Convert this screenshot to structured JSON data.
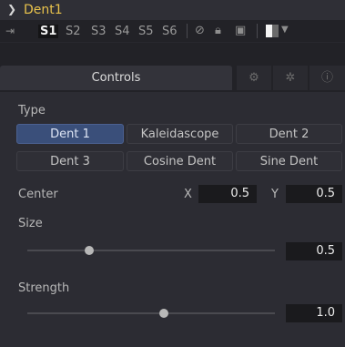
{
  "title": "Dent1",
  "versions": [
    "S1",
    "S2",
    "S3",
    "S4",
    "S5",
    "S6"
  ],
  "tabs": {
    "controls_label": "Controls"
  },
  "type_section": {
    "label": "Type",
    "options": [
      "Dent 1",
      "Kaleidascope",
      "Dent 2",
      "Dent 3",
      "Cosine Dent",
      "Sine Dent"
    ],
    "selected": "Dent 1"
  },
  "center": {
    "label": "Center",
    "x_label": "X",
    "x_value": "0.5",
    "y_label": "Y",
    "y_value": "0.5"
  },
  "size": {
    "label": "Size",
    "value": "0.5",
    "slider_fraction": 0.25
  },
  "strength": {
    "label": "Strength",
    "value": "1.0",
    "slider_fraction": 0.55
  },
  "icons": {
    "collapse": "chevron-down-icon",
    "pin": "pin-icon",
    "disable": "circle-slash-icon",
    "lock": "lock-icon",
    "save": "save-icon",
    "color": "color-swatch-icon",
    "tab2": "settings-cog-icon",
    "tab3": "gear-icon",
    "tab4": "info-icon"
  },
  "colors": {
    "title": "#e8c24c",
    "selected_button": "#3a4f7a"
  }
}
